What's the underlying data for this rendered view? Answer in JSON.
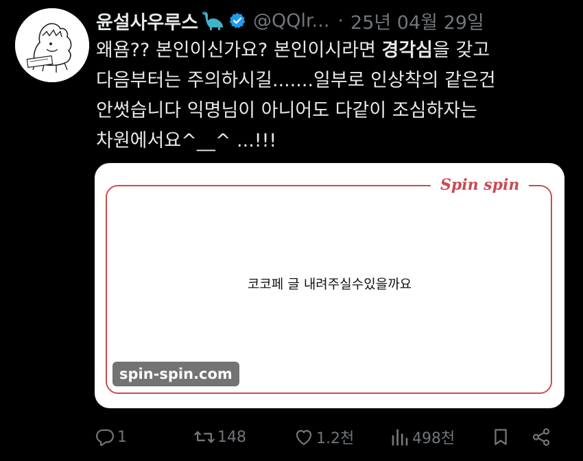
{
  "author": {
    "display_name": "윤설사우루스",
    "name_emoji_icon": "sauropod-icon",
    "verified_icon": "verified-badge-icon",
    "handle": "@QQlr...",
    "separator": "·",
    "timestamp": "25년 04월 29일",
    "avatar_icon": "dinosaur-sketch-avatar"
  },
  "tweet": {
    "line1": "왜욤?? 본인이신가요? 본인이시라면 ",
    "line1_bold": "경각심",
    "line1_end": "을 갖고",
    "line2": "다음부터는 주의하시길.......일부로 인상착의 같은건",
    "line3": "안썻습니다 익명님이 아니어도 다같이 조심하자는",
    "line4": "차원에서요^__^ ...!!!"
  },
  "media": {
    "brand": "Spin spin",
    "card_text": "코코페 글 내려주실수있을까요",
    "watermark": "spin-spin.com",
    "frame_color": "#c94a55"
  },
  "actions": {
    "reply_icon": "reply-icon",
    "reply_count": "1",
    "retweet_icon": "retweet-icon",
    "retweet_count": "148",
    "like_icon": "heart-icon",
    "like_count": "1.2천",
    "views_icon": "views-chart-icon",
    "views_count": "498천",
    "bookmark_icon": "bookmark-icon",
    "share_icon": "share-icon"
  },
  "colors": {
    "background": "#000000",
    "primary_text": "#e7e9ea",
    "secondary_text": "#71767b",
    "verified": "#1d9bf0",
    "accent_red": "#c94a55"
  }
}
